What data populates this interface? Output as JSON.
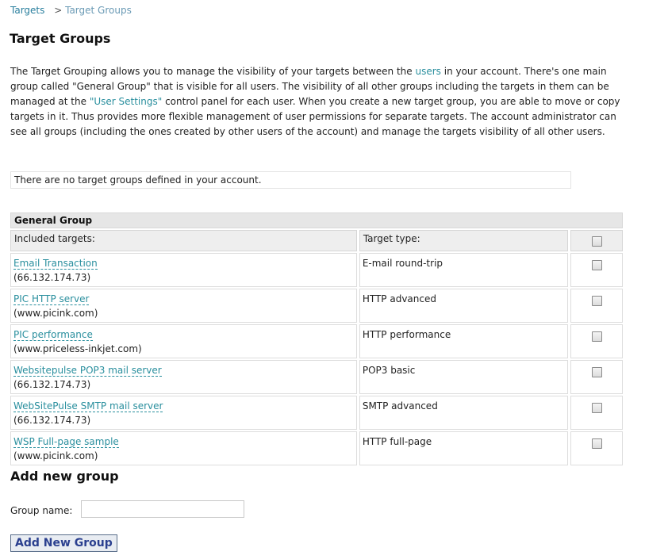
{
  "breadcrumb": {
    "root": "Targets",
    "separator": ">",
    "current": "Target Groups"
  },
  "page_title": "Target Groups",
  "intro": {
    "part1": "The Target Grouping allows you to manage the visibility of your targets between the ",
    "users_link": "users",
    "part2": " in your account. There's one main group called \"General Group\" that is visible for all users. The visibility of all other groups including the targets in them can be managed at the ",
    "user_settings_link": "\"User Settings\"",
    "part3": " control panel for each user. When you create a new target group, you are able to move or copy targets in it. Thus provides more flexible management of user permissions for separate targets. The account administrator can see all groups (including the ones created by other users of the account) and manage the targets visibility of all other users."
  },
  "notice": "There are no target groups defined in your account.",
  "general_group": {
    "title": "General Group",
    "col_targets": "Included targets:",
    "col_type": "Target type:",
    "rows": [
      {
        "name": "Email Transaction",
        "host": "(66.132.174.73)",
        "type": "E-mail round-trip"
      },
      {
        "name": "PIC HTTP server",
        "host": "(www.picink.com)",
        "type": "HTTP advanced"
      },
      {
        "name": "PIC performance",
        "host": "(www.priceless-inkjet.com)",
        "type": "HTTP performance"
      },
      {
        "name": "Websitepulse POP3 mail server",
        "host": "(66.132.174.73)",
        "type": "POP3 basic"
      },
      {
        "name": "WebSitePulse SMTP mail server",
        "host": "(66.132.174.73)",
        "type": "SMTP advanced"
      },
      {
        "name": "WSP Full-page sample",
        "host": "(www.picink.com)",
        "type": "HTTP full-page"
      }
    ]
  },
  "add_group": {
    "title": "Add new group",
    "label": "Group name:",
    "input_value": "",
    "button": "Add New Group"
  }
}
